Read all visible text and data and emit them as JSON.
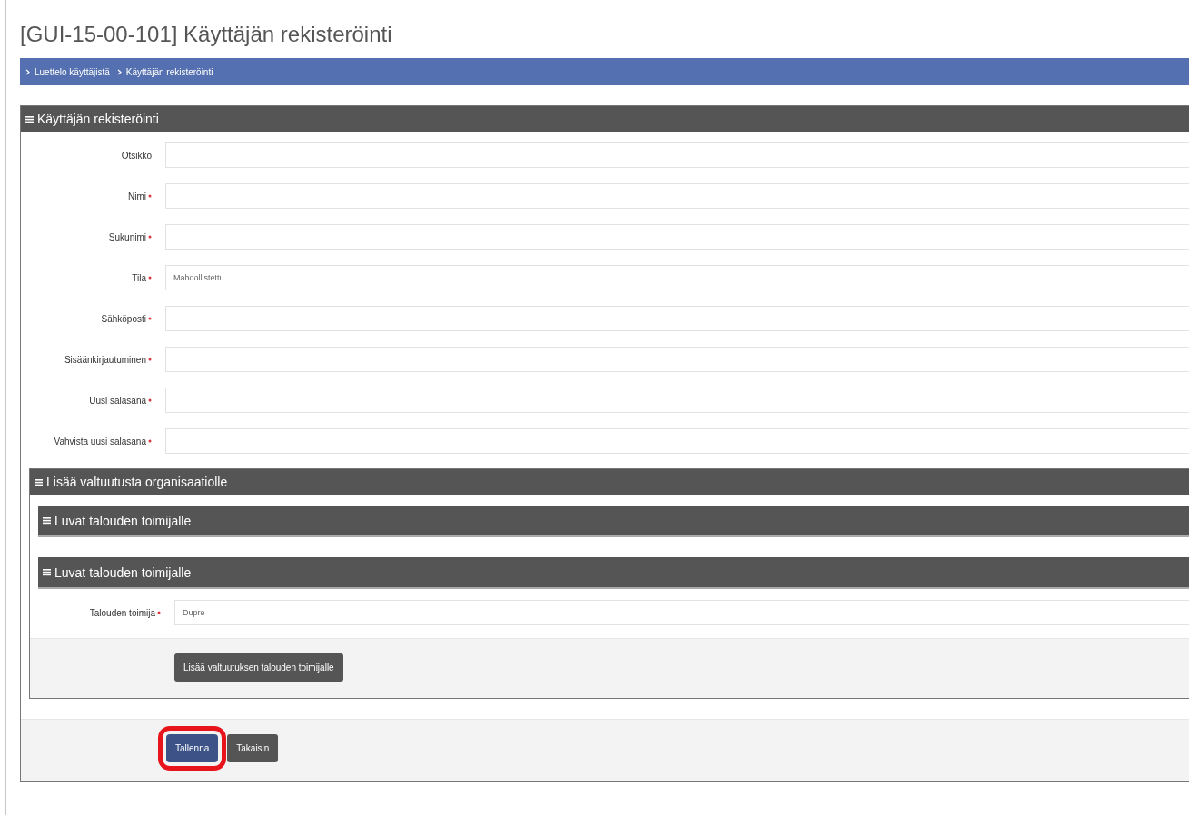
{
  "page_title": "[GUI-15-00-101] Käyttäjän rekisteröinti",
  "breadcrumb": [
    "Luettelo käyttäjistä",
    "Käyttäjän rekisteröinti"
  ],
  "panel": {
    "title": "Käyttäjän rekisteröinti",
    "fields": [
      {
        "label": "Otsikko",
        "required": false
      },
      {
        "label": "Nimi",
        "required": true
      },
      {
        "label": "Sukunimi",
        "required": true
      },
      {
        "label": "Tila",
        "required": true,
        "value": "Mahdollistettu"
      },
      {
        "label": "Sähköposti",
        "required": true
      },
      {
        "label": "Sisäänkirjautuminen",
        "required": true
      },
      {
        "label": "Uusi salasana",
        "required": true
      },
      {
        "label": "Vahvista uusi salasana",
        "required": true
      }
    ]
  },
  "subpanel": {
    "title": "Lisää valtuutusta organisaatiolle",
    "sections": [
      "Luvat talouden toimijalle",
      "Luvat talouden toimijalle"
    ],
    "field": {
      "label": "Talouden toimija",
      "required": true,
      "value": "Dupre"
    },
    "button": "Lisää valtuutuksen talouden toimijalle"
  },
  "buttons": [
    {
      "label": "Tallenna",
      "kind": "primary",
      "highlighted": true
    },
    {
      "label": "Takaisin",
      "kind": "secondary",
      "highlighted": false
    }
  ]
}
